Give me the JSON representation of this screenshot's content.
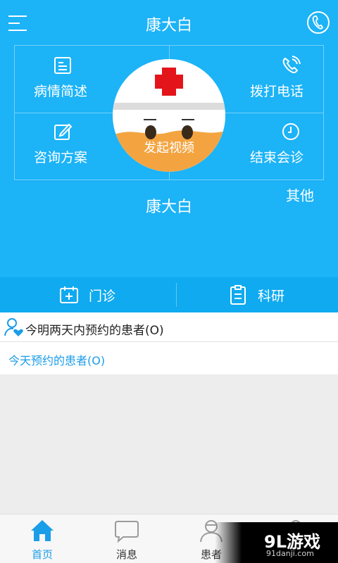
{
  "header": {
    "title": "康大白"
  },
  "grid": {
    "top_left": "病情简述",
    "top_right": "拨打电话",
    "bottom_left": "咨询方案",
    "bottom_right": "结束会诊",
    "center_button": "发起视频"
  },
  "name_under": "康大白",
  "other_label": "其他",
  "subtabs": {
    "clinic": "门诊",
    "research": "科研"
  },
  "list": {
    "two_days": "今明两天内预约的患者(O)",
    "today": "今天预约的患者(O)"
  },
  "tabbar": [
    {
      "label": "首页",
      "icon": "home-icon",
      "active": true
    },
    {
      "label": "消息",
      "icon": "message-icon",
      "active": false
    },
    {
      "label": "患者",
      "icon": "patient-icon",
      "active": false
    },
    {
      "label": "",
      "icon": "profile-icon",
      "active": false
    }
  ],
  "watermark": {
    "text": "9L游戏",
    "sub": "91danji.com"
  },
  "colors": {
    "primary": "#1cb3f7",
    "subbar": "#10aaf0",
    "accent": "#1b9de8"
  }
}
